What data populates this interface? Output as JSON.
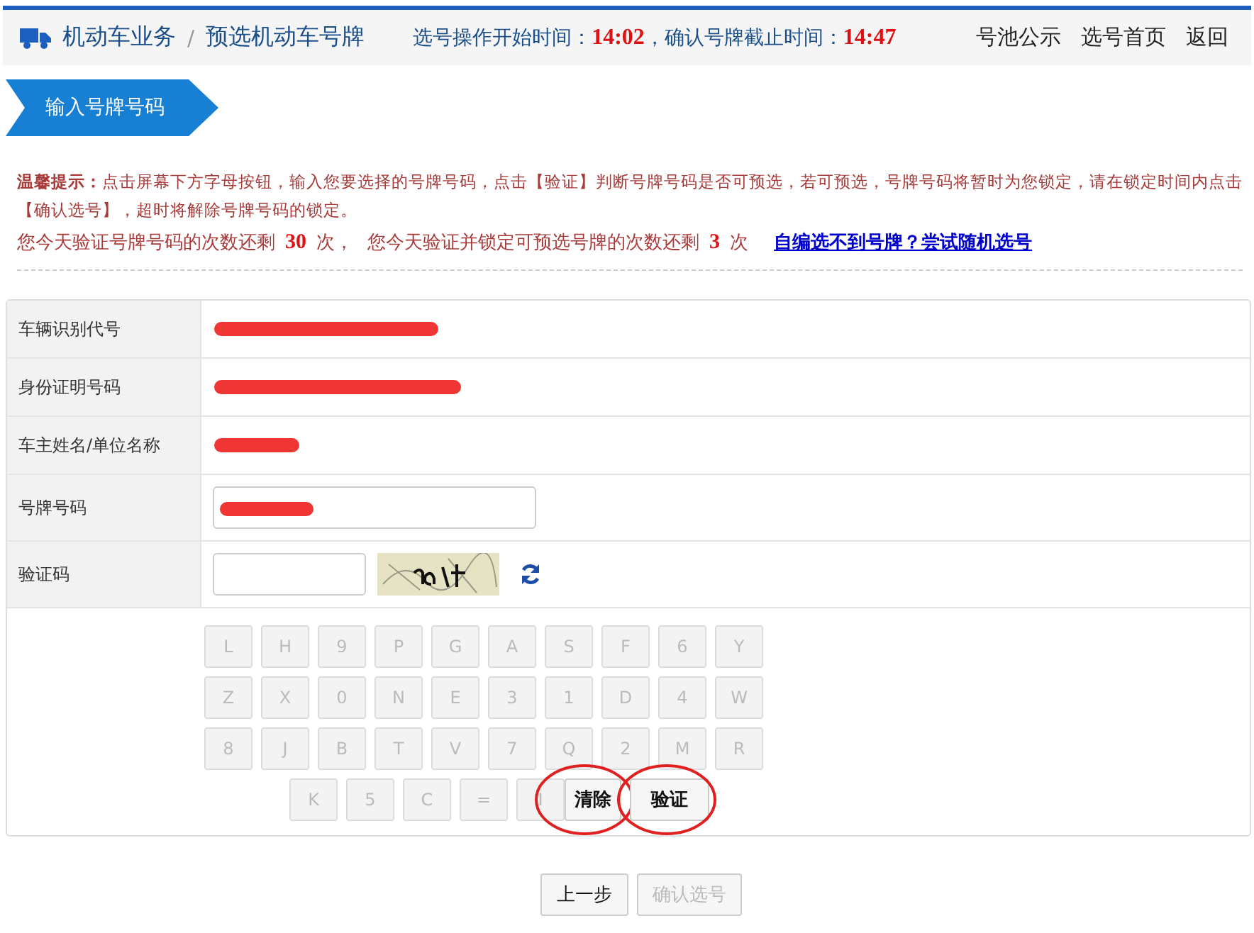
{
  "header": {
    "breadcrumb": [
      "机动车业务",
      "预选机动车号牌"
    ],
    "separator": "/",
    "start_label": "选号操作开始时间：",
    "start_time": "14:02",
    "deadline_label": "，确认号牌截止时间：",
    "deadline_time": "14:47",
    "links": [
      "号池公示",
      "选号首页",
      "返回"
    ]
  },
  "step": {
    "label": "输入号牌号码"
  },
  "notice": {
    "title": "温馨提示：",
    "text": "点击屏幕下方字母按钮，输入您要选择的号牌号码，点击【验证】判断号牌号码是否可预选，若可预选，号牌号码将暂时为您锁定，请在锁定时间内点击【确认选号】，超时将解除号牌号码的锁定。"
  },
  "counts": {
    "verify_text": "您今天验证号牌号码的次数还剩",
    "verify_count": "30",
    "verify_unit": "次，",
    "lock_text": "您今天验证并锁定可预选号牌的次数还剩",
    "lock_count": "3",
    "lock_unit": "次",
    "random_link": "自编选不到号牌？尝试随机选号"
  },
  "form": [
    {
      "kind": "text",
      "label": "车辆识别代号",
      "redacted": true
    },
    {
      "kind": "text",
      "label": "身份证明号码",
      "redacted": true
    },
    {
      "kind": "text",
      "label": "车主姓名/单位名称",
      "redacted": true
    },
    {
      "kind": "input",
      "label": "号牌号码",
      "redacted": true
    },
    {
      "kind": "captcha",
      "label": "验证码"
    }
  ],
  "keyboard": [
    [
      "L",
      "H",
      "9",
      "P",
      "G",
      "A",
      "S",
      "F",
      "6",
      "Y"
    ],
    [
      "Z",
      "X",
      "0",
      "N",
      "E",
      "3",
      "1",
      "D",
      "4",
      "W"
    ],
    [
      "8",
      "J",
      "B",
      "T",
      "V",
      "7",
      "Q",
      "2",
      "M",
      "R"
    ],
    [
      "K",
      "5",
      "C",
      "=",
      "I"
    ]
  ],
  "actions": [
    {
      "label": "清除",
      "disabled": false,
      "circled": true
    },
    {
      "label": "验证",
      "disabled": false,
      "circled": true
    }
  ],
  "footer": [
    {
      "label": "上一步",
      "disabled": false
    },
    {
      "label": "确认选号",
      "disabled": true
    }
  ]
}
